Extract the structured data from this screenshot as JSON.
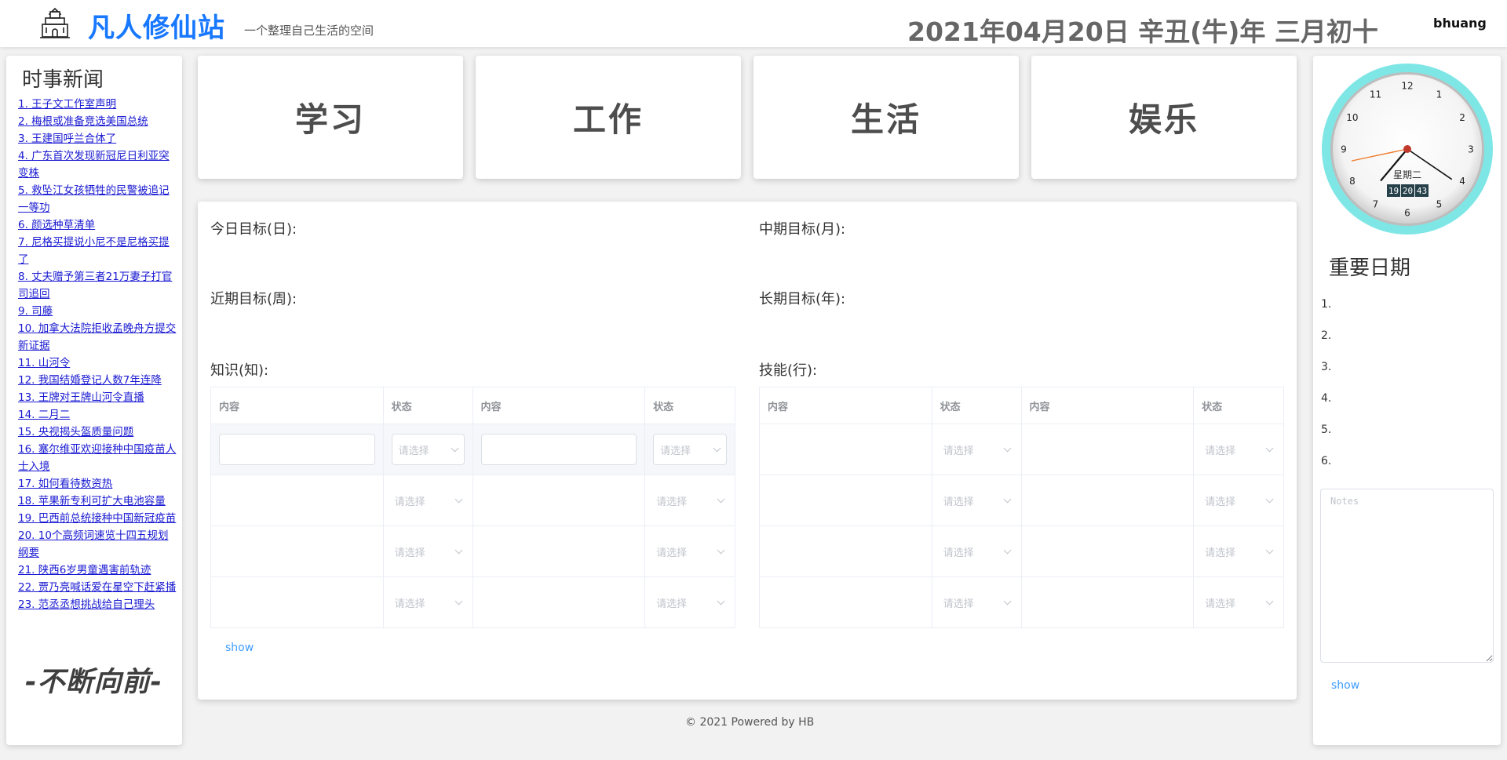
{
  "header": {
    "site_title": "凡人修仙站",
    "subtitle": "一个整理自己生活的空间",
    "date": "2021年04月20日 辛丑(牛)年 三月初十",
    "username": "bhuang"
  },
  "news": {
    "title": "时事新闻",
    "items": [
      "1. 王子文工作室声明",
      "2. 梅根或准备竞选美国总统",
      "3. 王建国呼兰合体了",
      "4. 广东首次发现新冠尼日利亚突变株",
      "5. 救坠江女孩牺牲的民警被追记一等功",
      "6. 颜选种草清单",
      "7. 尼格买提说小尼不是尼格买提了",
      "8. 丈夫赠予第三者21万妻子打官司追回",
      "9. 司藤",
      "10. 加拿大法院拒收孟晚舟方提交新证据",
      "11. 山河令",
      "12. 我国结婚登记人数7年连降",
      "13. 王牌对王牌山河令直播",
      "14. 二月二",
      "15. 央视揭头盔质量问题",
      "16. 塞尔维亚欢迎接种中国疫苗人士入境",
      "17. 如何看待数资热",
      "18. 苹果新专利可扩大电池容量",
      "19. 巴西前总统接种中国新冠疫苗",
      "20. 10个高频词速览十四五规划纲要",
      "21. 陕西6岁男童遇害前轨迹",
      "22. 贾乃亮喊话爱在星空下赶紧播",
      "23. 范丞丞想挑战给自己理头"
    ],
    "motto": "-不断向前-"
  },
  "categories": [
    "学习",
    "工作",
    "生活",
    "娱乐"
  ],
  "goals": {
    "daily": "今日目标(日):",
    "monthly": "中期目标(月):",
    "weekly": "近期目标(周):",
    "yearly": "长期目标(年):",
    "knowledge": "知识(知):",
    "skill": "技能(行):",
    "col_content": "内容",
    "col_status": "状态",
    "select_placeholder": "请选择",
    "show": "show"
  },
  "footer": "© 2021 Powered by HB",
  "clock": {
    "weekday": "星期二",
    "time_h": "19",
    "time_m": "20",
    "time_s": "43",
    "hour": 19,
    "minute": 20,
    "second": 43,
    "ring_color": "#7fe6e6"
  },
  "important": {
    "title": "重要日期",
    "items": [
      "1.",
      "2.",
      "3.",
      "4.",
      "5.",
      "6."
    ],
    "notes_placeholder": "Notes",
    "show": "show"
  }
}
